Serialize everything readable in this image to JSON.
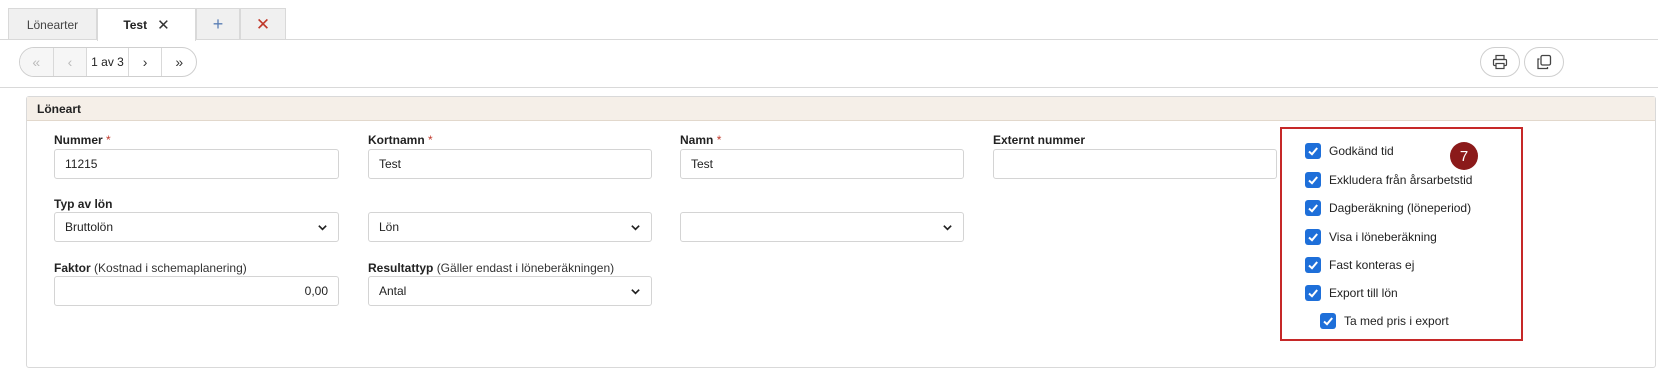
{
  "tabs": [
    {
      "label": "Lönearter"
    },
    {
      "label": "Test"
    }
  ],
  "pager": {
    "count": "1 av 3"
  },
  "panel": {
    "title": "Löneart"
  },
  "form": {
    "nummer": {
      "label": "Nummer",
      "required": "*",
      "value": "11215"
    },
    "kortnamn": {
      "label": "Kortnamn",
      "required": "*",
      "value": "Test"
    },
    "namn": {
      "label": "Namn",
      "required": "*",
      "value": "Test"
    },
    "externt": {
      "label": "Externt nummer",
      "value": ""
    },
    "typ": {
      "label": "Typ av lön",
      "value": "Bruttolön"
    },
    "typ2": {
      "value": "Lön"
    },
    "typ3": {
      "value": ""
    },
    "faktor": {
      "label": "Faktor",
      "hint": "(Kostnad i schemaplanering)",
      "value": "0,00"
    },
    "resultattyp": {
      "label": "Resultattyp",
      "hint": "(Gäller endast i löneberäkningen)",
      "value": "Antal"
    }
  },
  "checkboxes": [
    {
      "label": "Godkänd tid",
      "checked": true
    },
    {
      "label": "Exkludera från årsarbetstid",
      "checked": true
    },
    {
      "label": "Dagberäkning (löneperiod)",
      "checked": true
    },
    {
      "label": "Visa i löneberäkning",
      "checked": true
    },
    {
      "label": "Fast konteras ej",
      "checked": true
    },
    {
      "label": "Export till lön",
      "checked": true
    },
    {
      "label": "Ta med pris i export",
      "checked": true
    }
  ],
  "badge": {
    "text": "7"
  },
  "colors": {
    "accent": "#1e6fd9",
    "highlight": "#c62828",
    "badge": "#8b1a1a",
    "danger": "#c0392b"
  }
}
